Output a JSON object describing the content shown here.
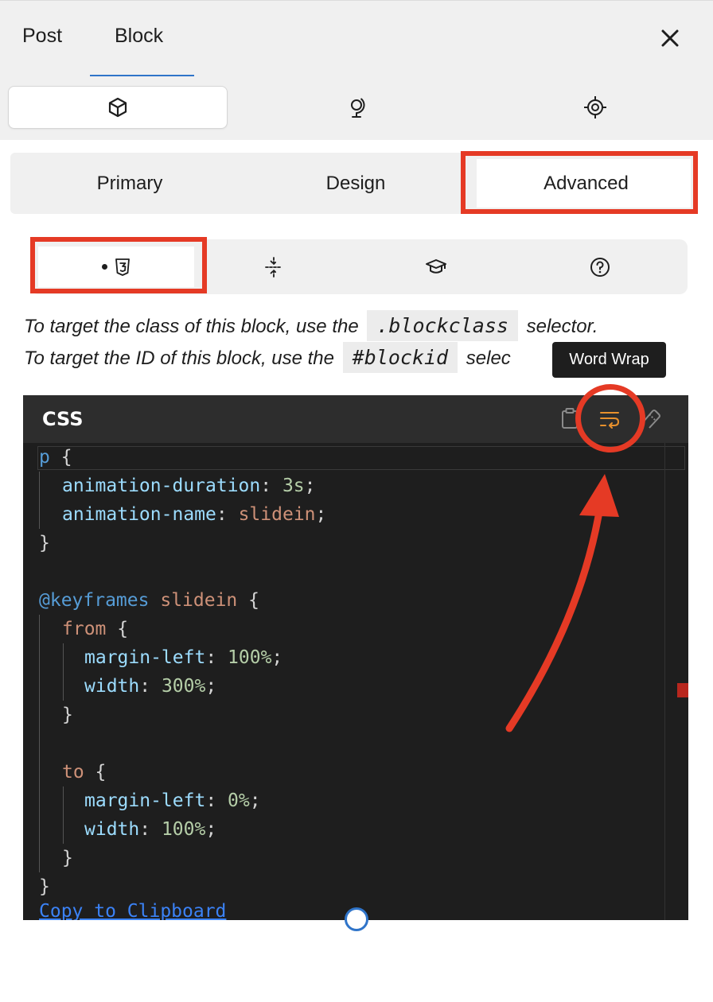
{
  "header": {
    "tabs": [
      {
        "label": "Post",
        "active": false
      },
      {
        "label": "Block",
        "active": true
      }
    ],
    "close_icon": "close-icon"
  },
  "icon_tabs": [
    {
      "icon": "cube-icon",
      "active": true
    },
    {
      "icon": "globe-stand-icon",
      "active": false
    },
    {
      "icon": "target-icon",
      "active": false
    }
  ],
  "segment_tabs": [
    {
      "label": "Primary",
      "active": false
    },
    {
      "label": "Design",
      "active": false
    },
    {
      "label": "Advanced",
      "active": true
    }
  ],
  "sub_tabs": [
    {
      "icon": "css3-icon",
      "active": true,
      "has_dot": true
    },
    {
      "icon": "compress-icon",
      "active": false
    },
    {
      "icon": "graduation-cap-icon",
      "active": false
    },
    {
      "icon": "help-circle-icon",
      "active": false
    }
  ],
  "help": {
    "line1_pre": "To target the class of this block, use the",
    "line1_code": ".blockclass",
    "line1_post": "selector.",
    "line2_pre": "To target the ID of this block, use the",
    "line2_code": "#blockid",
    "line2_post": "selec"
  },
  "tooltip": "Word Wrap",
  "editor": {
    "title": "CSS",
    "toolbar_icons": [
      "clipboard-icon",
      "word-wrap-icon",
      "eraser-icon"
    ],
    "copy_link": "Copy to Clipboard"
  },
  "code": {
    "l1_sel": "p",
    "l1_brace": " {",
    "l2_prop": "animation-duration",
    "l2_val": "3s",
    "l3_prop": "animation-name",
    "l3_val": "slidein",
    "l4": "}",
    "l6_at": "@keyframes",
    "l6_name": "slidein",
    "l6_brace": " {",
    "l7_kw": "from",
    "l7_brace": " {",
    "l8_prop": "margin-left",
    "l8_val": "100%",
    "l9_prop": "width",
    "l9_val": "300%",
    "l10": "}",
    "l12_kw": "to",
    "l12_brace": " {",
    "l13_prop": "margin-left",
    "l13_val": "0%",
    "l14_prop": "width",
    "l14_val": "100%",
    "l15": "}",
    "l16": "}",
    "colon": ": ",
    "semi": ";"
  },
  "colors": {
    "annotation": "#e53a25",
    "accent": "#2f74c9",
    "editor_bg": "#1e1e1e"
  }
}
